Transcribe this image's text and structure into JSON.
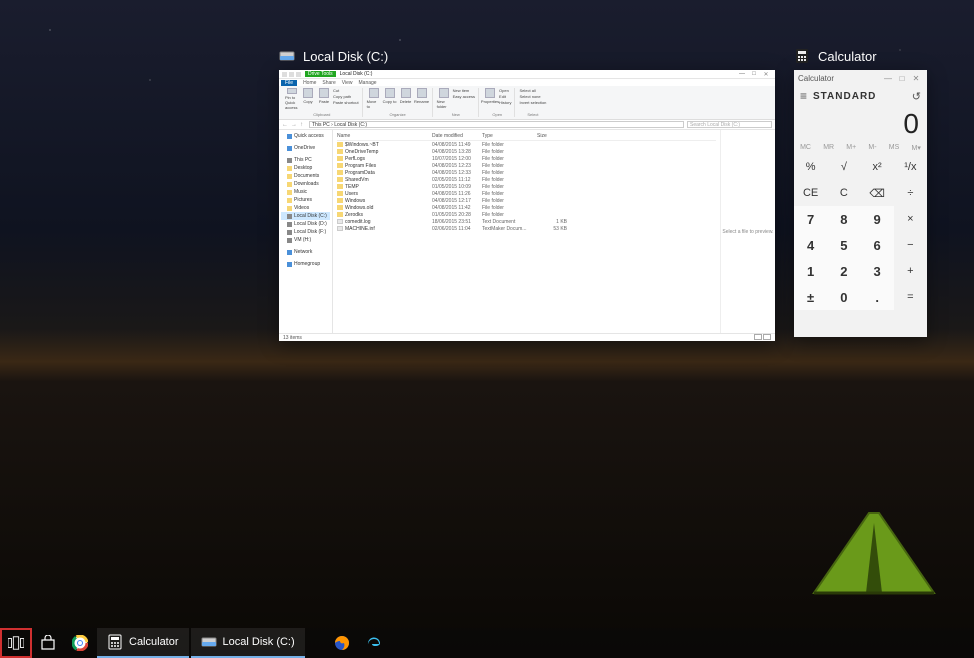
{
  "taskview": {
    "windows": [
      {
        "title": "Local Disk (C:)"
      },
      {
        "title": "Calculator"
      }
    ]
  },
  "file_explorer": {
    "qat_drive_tag": "Drive Tools",
    "title_path": "Local Disk (C:)",
    "tabs": {
      "file": "File",
      "home": "Home",
      "share": "Share",
      "view": "View",
      "manage": "Manage"
    },
    "ribbon": {
      "clipboard": {
        "pin": "Pin to Quick access",
        "copy": "Copy",
        "paste": "Paste",
        "cut": "Cut",
        "copypath": "Copy path",
        "shortcut": "Paste shortcut",
        "label": "Clipboard"
      },
      "organize": {
        "move": "Move to",
        "copyto": "Copy to",
        "delete": "Delete",
        "rename": "Rename",
        "label": "Organize"
      },
      "new": {
        "newfolder": "New folder",
        "newitem": "New item",
        "easyaccess": "Easy access",
        "label": "New"
      },
      "open": {
        "properties": "Properties",
        "open": "Open",
        "edit": "Edit",
        "history": "History",
        "label": "Open"
      },
      "select": {
        "all": "Select all",
        "none": "Select none",
        "invert": "Invert selection",
        "label": "Select"
      }
    },
    "address": {
      "path": "This PC  ›  Local Disk (C:)",
      "search_placeholder": "Search Local Disk (C:)"
    },
    "nav": [
      {
        "label": "Quick access",
        "cls": "star"
      },
      {
        "label": "",
        "cls": "sep"
      },
      {
        "label": "OneDrive",
        "cls": "star"
      },
      {
        "label": "",
        "cls": "sep"
      },
      {
        "label": "This PC",
        "cls": "drive"
      },
      {
        "label": "Desktop",
        "cls": "fold"
      },
      {
        "label": "Documents",
        "cls": "fold"
      },
      {
        "label": "Downloads",
        "cls": "fold"
      },
      {
        "label": "Music",
        "cls": "fold"
      },
      {
        "label": "Pictures",
        "cls": "fold"
      },
      {
        "label": "Videos",
        "cls": "fold"
      },
      {
        "label": "Local Disk (C:)",
        "cls": "drive sel"
      },
      {
        "label": "Local Disk (D:)",
        "cls": "drive"
      },
      {
        "label": "Local Disk (F:)",
        "cls": "drive"
      },
      {
        "label": "VM (H:)",
        "cls": "drive"
      },
      {
        "label": "",
        "cls": "sep"
      },
      {
        "label": "Network",
        "cls": "star"
      },
      {
        "label": "",
        "cls": "sep"
      },
      {
        "label": "Homegroup",
        "cls": "star"
      }
    ],
    "columns": [
      "Name",
      "Date modified",
      "Type",
      "Size"
    ],
    "files": [
      {
        "ic": "fold",
        "name": "$Windows.~BT",
        "date": "04/08/2015 11:49",
        "type": "File folder",
        "size": ""
      },
      {
        "ic": "fold",
        "name": "OneDriveTemp",
        "date": "04/08/2015 13:28",
        "type": "File folder",
        "size": ""
      },
      {
        "ic": "fold",
        "name": "PerfLogs",
        "date": "10/07/2015 12:00",
        "type": "File folder",
        "size": ""
      },
      {
        "ic": "fold",
        "name": "Program Files",
        "date": "04/08/2015 12:23",
        "type": "File folder",
        "size": ""
      },
      {
        "ic": "fold",
        "name": "ProgramData",
        "date": "04/08/2015 12:33",
        "type": "File folder",
        "size": ""
      },
      {
        "ic": "fold",
        "name": "SharedVm",
        "date": "02/05/2015 11:12",
        "type": "File folder",
        "size": ""
      },
      {
        "ic": "fold",
        "name": "TEMP",
        "date": "01/05/2015 10:09",
        "type": "File folder",
        "size": ""
      },
      {
        "ic": "fold",
        "name": "Users",
        "date": "04/08/2015 11:26",
        "type": "File folder",
        "size": ""
      },
      {
        "ic": "fold",
        "name": "Windows",
        "date": "04/08/2015 12:17",
        "type": "File folder",
        "size": ""
      },
      {
        "ic": "fold",
        "name": "Windows.old",
        "date": "04/08/2015 11:42",
        "type": "File folder",
        "size": ""
      },
      {
        "ic": "fold",
        "name": "Zerodks",
        "date": "01/05/2015 20:28",
        "type": "File folder",
        "size": ""
      },
      {
        "ic": "file",
        "name": "comedit.log",
        "date": "18/06/2015 23:51",
        "type": "Text Document",
        "size": "1 KB"
      },
      {
        "ic": "file",
        "name": "MACHINE.inf",
        "date": "02/06/2015 11:04",
        "type": "TextMaker Docum...",
        "size": "53 KB"
      }
    ],
    "preview_text": "Select a file to preview.",
    "status": "13 items"
  },
  "calculator": {
    "title": "Calculator",
    "mode": "STANDARD",
    "display": "0",
    "mem": [
      "MC",
      "MR",
      "M+",
      "M-",
      "MS",
      "M▾"
    ],
    "keys": [
      [
        "%",
        "√",
        "x²",
        "¹/x"
      ],
      [
        "CE",
        "C",
        "⌫",
        "÷"
      ],
      [
        "7",
        "8",
        "9",
        "×"
      ],
      [
        "4",
        "5",
        "6",
        "−"
      ],
      [
        "1",
        "2",
        "3",
        "+"
      ],
      [
        "±",
        "0",
        ".",
        "="
      ]
    ]
  },
  "taskbar": {
    "calculator": "Calculator",
    "localdisk": "Local Disk (C:)"
  }
}
